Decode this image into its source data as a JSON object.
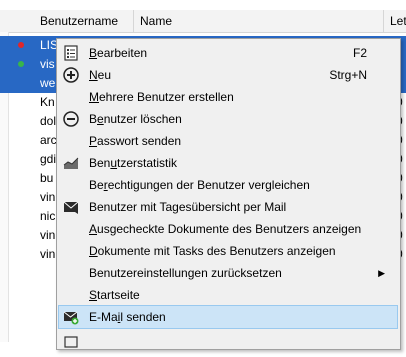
{
  "table": {
    "columns": [
      "Benutzername",
      "Name",
      "Let"
    ],
    "rows": [
      {
        "user": "LIS",
        "tail": "",
        "selected": true,
        "dot": "#e0262a"
      },
      {
        "user": "vis",
        "tail": "",
        "selected": true,
        "dot": "#38b54a"
      },
      {
        "user": "we",
        "tail": "",
        "selected": true,
        "dot": ""
      },
      {
        "user": "Kn",
        "tail": "0",
        "selected": false,
        "dot": ""
      },
      {
        "user": "dol",
        "tail": "0",
        "selected": false,
        "dot": ""
      },
      {
        "user": "arc",
        "tail": "0",
        "selected": false,
        "dot": ""
      },
      {
        "user": "gdi",
        "tail": "0",
        "selected": false,
        "dot": ""
      },
      {
        "user": "bu",
        "tail": "0",
        "selected": false,
        "dot": ""
      },
      {
        "user": "vin",
        "tail": "0",
        "selected": false,
        "dot": ""
      },
      {
        "user": "nic",
        "tail": "0",
        "selected": false,
        "dot": ""
      },
      {
        "user": "vin",
        "tail": "0",
        "selected": false,
        "dot": ""
      },
      {
        "user": "vin",
        "tail": "0",
        "selected": false,
        "dot": ""
      }
    ]
  },
  "menu": {
    "items": [
      {
        "pre": "",
        "ul": "B",
        "post": "earbeiten",
        "shortcut": "F2",
        "icon": "edit-icon"
      },
      {
        "pre": "",
        "ul": "N",
        "post": "eu",
        "shortcut": "Strg+N",
        "icon": "add-icon"
      },
      {
        "pre": "",
        "ul": "M",
        "post": "ehrere Benutzer erstellen",
        "shortcut": "",
        "icon": ""
      },
      {
        "pre": "B",
        "ul": "e",
        "post": "nutzer löschen",
        "shortcut": "",
        "icon": "remove-icon"
      },
      {
        "pre": "",
        "ul": "P",
        "post": "asswort senden",
        "shortcut": "",
        "icon": ""
      },
      {
        "pre": "Ben",
        "ul": "u",
        "post": "tzerstatistik",
        "shortcut": "",
        "icon": "statistics-icon"
      },
      {
        "pre": "Be",
        "ul": "r",
        "post": "echtigungen der Benutzer vergleichen",
        "shortcut": "",
        "icon": ""
      },
      {
        "pre": "Benutzer mit Tagesübersicht per Mail",
        "ul": "",
        "post": "",
        "shortcut": "",
        "icon": "mail-summary-icon"
      },
      {
        "pre": "",
        "ul": "A",
        "post": "usgecheckte Dokumente des Benutzers anzeigen",
        "shortcut": "",
        "icon": ""
      },
      {
        "pre": "",
        "ul": "D",
        "post": "okumente mit Tasks des Benutzers anzeigen",
        "shortcut": "",
        "icon": ""
      },
      {
        "pre": "Benutzereinstellungen zurücksetzen",
        "ul": "",
        "post": "",
        "shortcut": "",
        "icon": "",
        "submenu": true
      },
      {
        "pre": "",
        "ul": "S",
        "post": "tartseite",
        "shortcut": "",
        "icon": ""
      },
      {
        "pre": "E-Ma",
        "ul": "i",
        "post": "l senden",
        "shortcut": "",
        "icon": "send-mail-icon",
        "highlighted": true
      },
      {
        "pre": "",
        "ul": "",
        "post": "",
        "shortcut": "",
        "icon": "partial-icon"
      }
    ]
  }
}
